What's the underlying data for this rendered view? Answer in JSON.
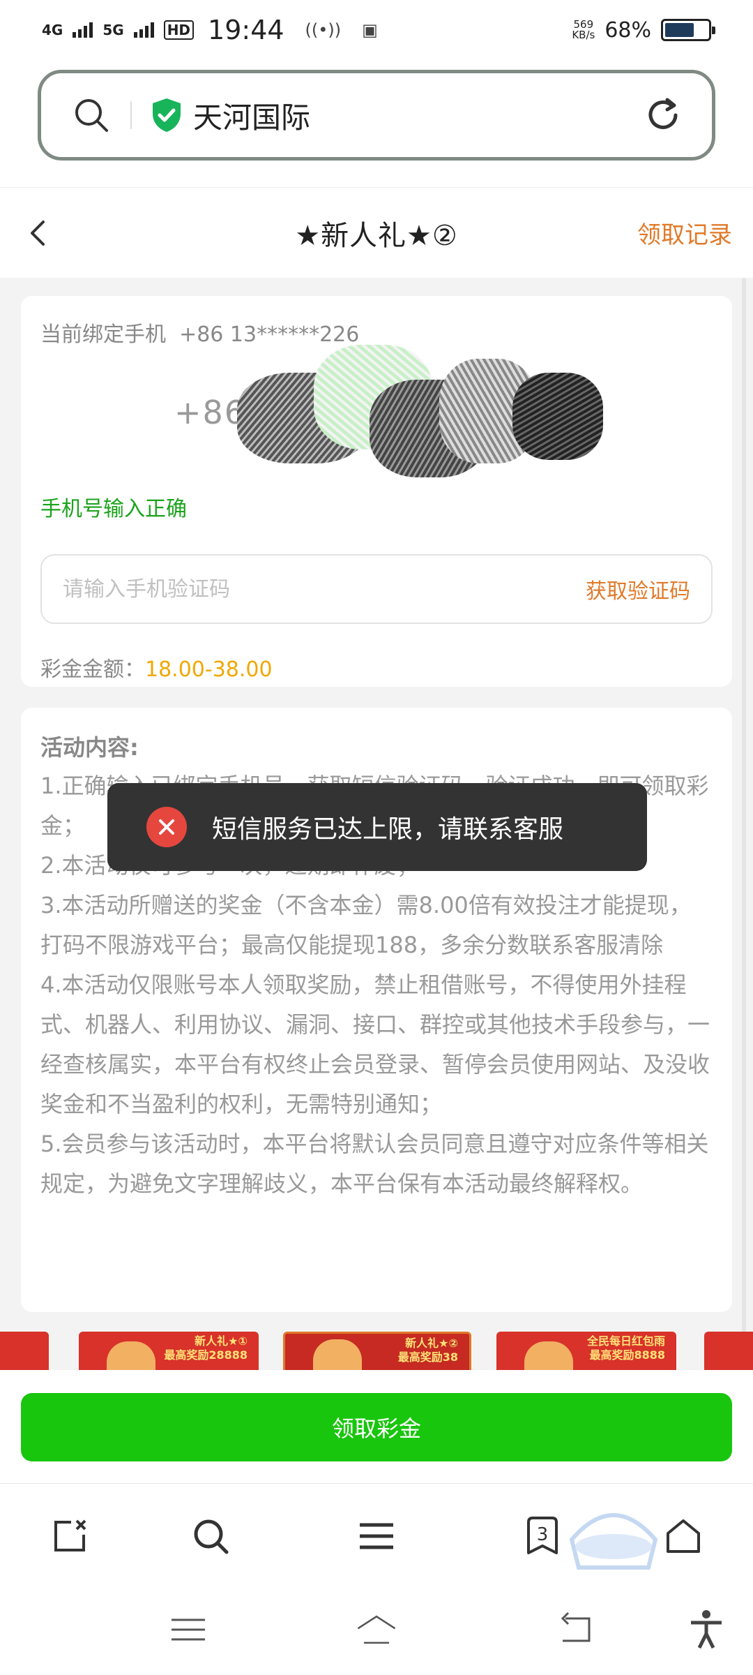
{
  "status_bar": {
    "network1": "4G",
    "network2": "5G",
    "hd_badge": "HD",
    "time": "19:44",
    "speed_value": "569",
    "speed_unit": "KB/s",
    "battery_percent": "68%",
    "battery_level": 0.68
  },
  "address_bar": {
    "site_name": "天河国际"
  },
  "page_header": {
    "title": "★新人礼★②",
    "records_link": "领取记录"
  },
  "bind_card": {
    "bound_phone_label": "当前绑定手机",
    "bound_phone_value": "+86 13******226",
    "phone_prefix": "+86",
    "valid_message": "手机号输入正确",
    "code_placeholder": "请输入手机验证码",
    "get_code_label": "获取验证码",
    "amount_label": "彩金金额：",
    "amount_value": "18.00-38.00"
  },
  "rules": {
    "title": "活动内容:",
    "items": [
      "1.正确输入已绑定手机号，获取短信验证码，验证成功，即可领取彩金；",
      "2.本活动仅可参与一次，过期即作废；",
      "3.本活动所赠送的奖金（不含本金）需8.00倍有效投注才能提现，打码不限游戏平台；最高仅能提现188，多余分数联系客服清除",
      "4.本活动仅限账号本人领取奖励，禁止租借账号，不得使用外挂程式、机器人、利用协议、漏洞、接口、群控或其他技术手段参与，一经查核属实，本平台有权终止会员登录、暂停会员使用网站、及没收奖金和不当盈利的权利，无需特别通知；",
      "5.会员参与该活动时，本平台将默认会员同意且遵守对应条件等相关规定，为避免文字理解歧义，本平台保有本活动最终解释权。"
    ]
  },
  "toast": {
    "message": "短信服务已达上限，请联系客服"
  },
  "banners": [
    {
      "line1": "新人礼★①",
      "line2": "最高奖励28888"
    },
    {
      "line1": "新人礼★②",
      "line2": "最高奖励38"
    },
    {
      "line1": "全民每日红包雨",
      "line2": "最高奖励8888"
    }
  ],
  "claim_button": {
    "label": "领取彩金"
  },
  "browser_toolbar": {
    "tabs_count": "3"
  },
  "colors": {
    "accent_green": "#18c60d",
    "link_orange": "#e07a2a",
    "amount_gold": "#f0a800",
    "error_red": "#e5473f",
    "valid_green": "#1ba31b"
  }
}
